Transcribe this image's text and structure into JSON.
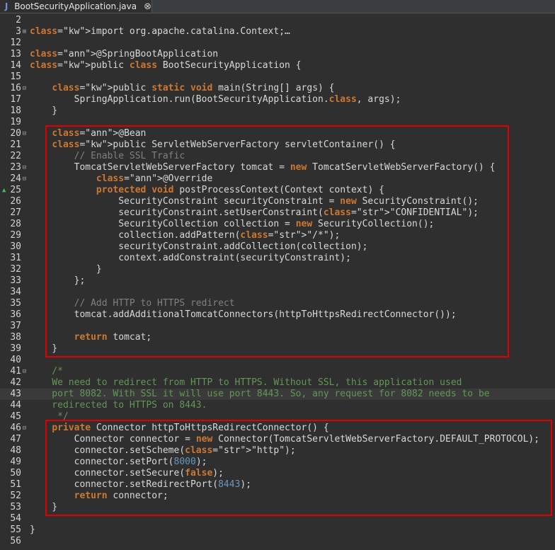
{
  "tab": {
    "title": "BootSecurityApplication.java",
    "icon": "java-file-icon",
    "close_glyph": "⊗"
  },
  "colors": {
    "background": "#2f2f2f",
    "current_line": "#3a3a3a",
    "highlight_frame": "#e00000",
    "keyword": "#cc7832",
    "annotation": "#bbb529",
    "field": "#6897bb",
    "comment": "#808080",
    "javadoc": "#629755"
  },
  "editor": {
    "current_line": "43",
    "lines": [
      {
        "n": "2",
        "code": ""
      },
      {
        "n": "3",
        "code": "import org.apache.catalina.Context;…",
        "fold": "+"
      },
      {
        "n": "12",
        "code": ""
      },
      {
        "n": "13",
        "code": "@SpringBootApplication"
      },
      {
        "n": "14",
        "code": "public class BootSecurityApplication {"
      },
      {
        "n": "15",
        "code": ""
      },
      {
        "n": "16",
        "code": "    public static void main(String[] args) {",
        "fold": "-"
      },
      {
        "n": "17",
        "code": "        SpringApplication.run(BootSecurityApplication.class, args);"
      },
      {
        "n": "18",
        "code": "    }"
      },
      {
        "n": "19",
        "code": ""
      },
      {
        "n": "20",
        "code": "    @Bean",
        "fold": "-"
      },
      {
        "n": "21",
        "code": "    public ServletWebServerFactory servletContainer() {"
      },
      {
        "n": "22",
        "code": "        // Enable SSL Trafic"
      },
      {
        "n": "23",
        "code": "        TomcatServletWebServerFactory tomcat = new TomcatServletWebServerFactory() {",
        "fold": "-"
      },
      {
        "n": "24",
        "code": "            @Override",
        "fold": "-"
      },
      {
        "n": "25",
        "code": "            protected void postProcessContext(Context context) {",
        "override": true
      },
      {
        "n": "26",
        "code": "                SecurityConstraint securityConstraint = new SecurityConstraint();"
      },
      {
        "n": "27",
        "code": "                securityConstraint.setUserConstraint(\"CONFIDENTIAL\");"
      },
      {
        "n": "28",
        "code": "                SecurityCollection collection = new SecurityCollection();"
      },
      {
        "n": "29",
        "code": "                collection.addPattern(\"/*\");"
      },
      {
        "n": "30",
        "code": "                securityConstraint.addCollection(collection);"
      },
      {
        "n": "31",
        "code": "                context.addConstraint(securityConstraint);"
      },
      {
        "n": "32",
        "code": "            }"
      },
      {
        "n": "33",
        "code": "        };"
      },
      {
        "n": "34",
        "code": ""
      },
      {
        "n": "35",
        "code": "        // Add HTTP to HTTPS redirect"
      },
      {
        "n": "36",
        "code": "        tomcat.addAdditionalTomcatConnectors(httpToHttpsRedirectConnector());"
      },
      {
        "n": "37",
        "code": ""
      },
      {
        "n": "38",
        "code": "        return tomcat;"
      },
      {
        "n": "39",
        "code": "    }"
      },
      {
        "n": "40",
        "code": ""
      },
      {
        "n": "41",
        "code": "    /*",
        "fold": "-"
      },
      {
        "n": "42",
        "code": "    We need to redirect from HTTP to HTTPS. Without SSL, this application used"
      },
      {
        "n": "43",
        "code": "    port 8082. With SSL it will use port 8443. So, any request for 8082 needs to be"
      },
      {
        "n": "44",
        "code": "    redirected to HTTPS on 8443."
      },
      {
        "n": "45",
        "code": "     */"
      },
      {
        "n": "46",
        "code": "    private Connector httpToHttpsRedirectConnector() {",
        "fold": "-"
      },
      {
        "n": "47",
        "code": "        Connector connector = new Connector(TomcatServletWebServerFactory.DEFAULT_PROTOCOL);"
      },
      {
        "n": "48",
        "code": "        connector.setScheme(\"http\");"
      },
      {
        "n": "49",
        "code": "        connector.setPort(8000);"
      },
      {
        "n": "50",
        "code": "        connector.setSecure(false);"
      },
      {
        "n": "51",
        "code": "        connector.setRedirectPort(8443);"
      },
      {
        "n": "52",
        "code": "        return connector;"
      },
      {
        "n": "53",
        "code": "    }"
      },
      {
        "n": "54",
        "code": ""
      },
      {
        "n": "55",
        "code": "}"
      },
      {
        "n": "56",
        "code": ""
      }
    ]
  }
}
